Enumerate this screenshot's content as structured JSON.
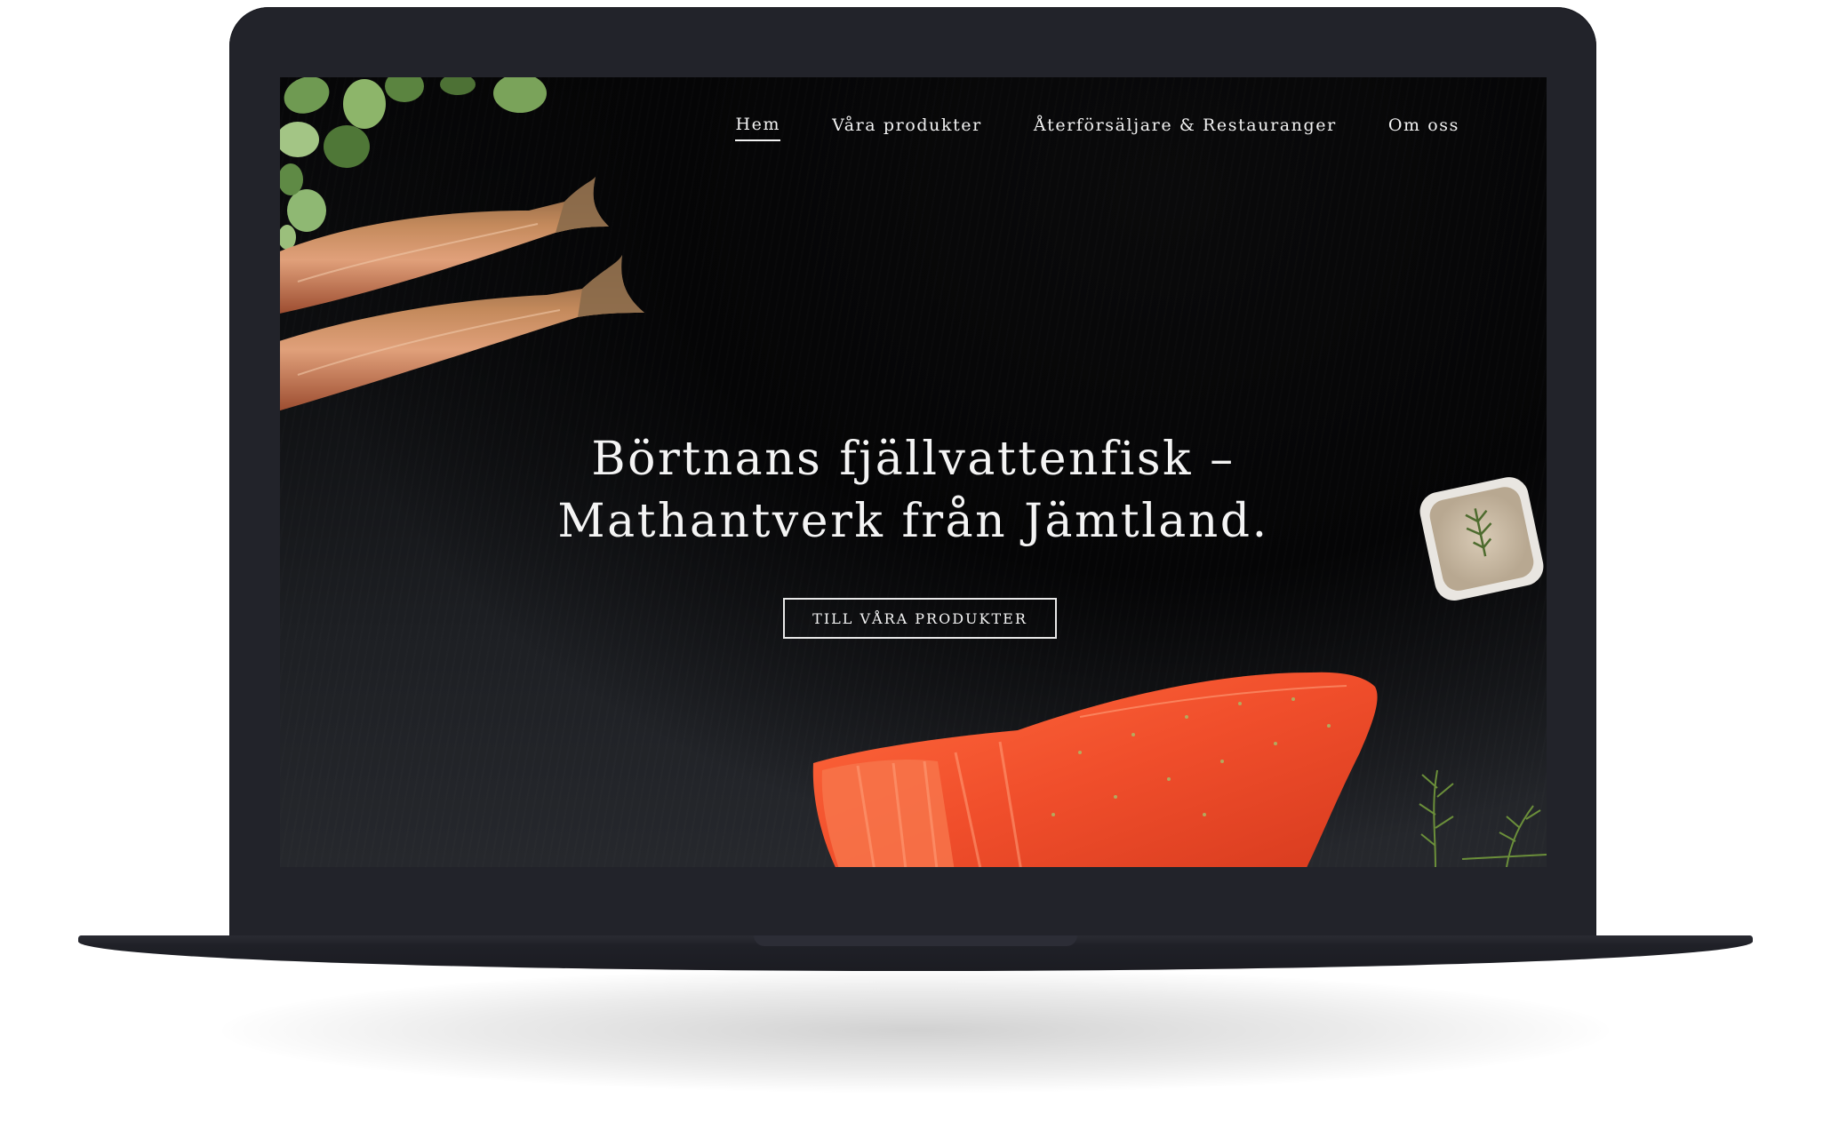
{
  "nav": {
    "items": [
      {
        "label": "Hem",
        "active": true
      },
      {
        "label": "Våra produkter",
        "active": false
      },
      {
        "label": "Återförsäljare & Restauranger",
        "active": false
      },
      {
        "label": "Om oss",
        "active": false
      }
    ]
  },
  "hero": {
    "title_line1": "Börtnans fjällvattenfisk –",
    "title_line2": "Mathantverk från Jämtland.",
    "cta_label": "TILL VÅRA PRODUKTER"
  },
  "colors": {
    "mockup_frame": "#22232a",
    "screen_background": "#0b0c0e",
    "text": "#f4f4f4",
    "salmon": "#e8472a",
    "smoked_fish": "#b8653f",
    "leaf": "#6f9a52"
  }
}
